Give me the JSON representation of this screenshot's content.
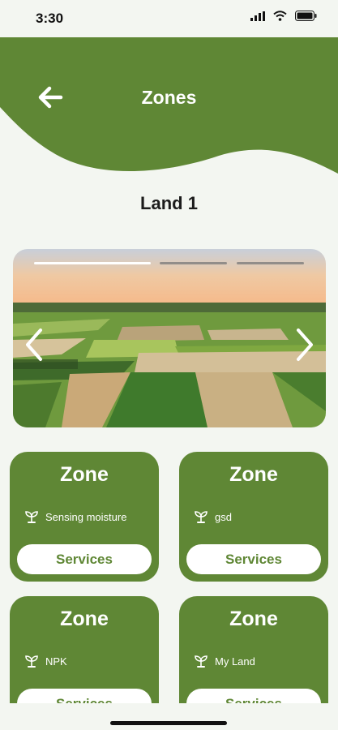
{
  "status_bar": {
    "time": "3:30",
    "icons": [
      "signal-icon",
      "wifi-icon",
      "battery-icon"
    ]
  },
  "header": {
    "title": "Zones",
    "back_icon": "arrow-left-icon",
    "background_color": "#5f8735"
  },
  "land": {
    "title": "Land 1"
  },
  "carousel": {
    "slide_count": 3,
    "active_index": 0,
    "prev_icon": "chevron-left-icon",
    "next_icon": "chevron-right-icon",
    "image": "aerial-farmland-sunset"
  },
  "zones": [
    {
      "title": "Zone",
      "sensor_icon": "plant-sprout-icon",
      "sensor_label": "Sensing moisture",
      "button_label": "Services"
    },
    {
      "title": "Zone",
      "sensor_icon": "plant-sprout-icon",
      "sensor_label": "gsd",
      "button_label": "Services"
    },
    {
      "title": "Zone",
      "sensor_icon": "plant-sprout-icon",
      "sensor_label": "NPK",
      "button_label": "Services"
    },
    {
      "title": "Zone",
      "sensor_icon": "plant-sprout-icon",
      "sensor_label": "My Land",
      "button_label": "Services"
    }
  ],
  "colors": {
    "primary": "#5f8735",
    "background": "#f3f6f1",
    "card_text": "#ffffff",
    "button_bg": "#ffffff"
  }
}
